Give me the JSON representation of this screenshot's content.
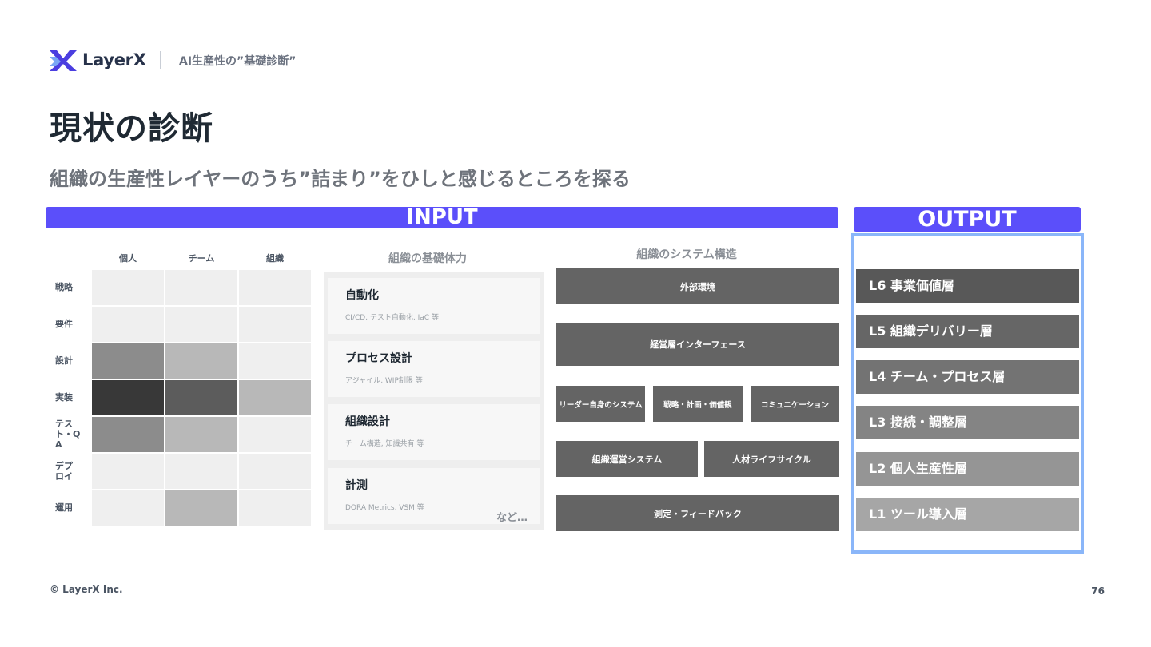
{
  "header": {
    "logo_text": "LayerX",
    "subtitle": "AI生産性の”基礎診断”"
  },
  "title": "現状の診断",
  "subtitle": "組織の生産性レイヤーのうち”詰まり”をひしと感じるところを探る",
  "input_label": "INPUT",
  "output_label": "OUTPUT",
  "matrix": {
    "columns": [
      "個人",
      "チーム",
      "組織"
    ],
    "rows": [
      "戦略",
      "要件",
      "設計",
      "実装",
      "テスト・QA",
      "デプロイ",
      "運用"
    ],
    "cell_colors": [
      [
        "#efefef",
        "#efefef",
        "#efefef"
      ],
      [
        "#efefef",
        "#efefef",
        "#efefef"
      ],
      [
        "#8c8c8c",
        "#b8b8b8",
        "#efefef"
      ],
      [
        "#383838",
        "#5c5c5c",
        "#b8b8b8"
      ],
      [
        "#8c8c8c",
        "#b8b8b8",
        "#efefef"
      ],
      [
        "#efefef",
        "#efefef",
        "#efefef"
      ],
      [
        "#efefef",
        "#b8b8b8",
        "#efefef"
      ]
    ]
  },
  "foundation": {
    "title": "組織の基礎体力",
    "cards": [
      {
        "title": "自動化",
        "desc": "CI/CD, テスト自動化, IaC 等"
      },
      {
        "title": "プロセス設計",
        "desc": "アジャイル, WIP制限 等"
      },
      {
        "title": "組織設計",
        "desc": "チーム構造, 知識共有 等"
      },
      {
        "title": "計測",
        "desc": "DORA Metrics, VSM 等"
      }
    ],
    "more": "など…"
  },
  "system": {
    "title": "組織のシステム構造",
    "boxes": {
      "external": "外部環境",
      "management_interface": "経営層インターフェース",
      "leader_system": "リーダー自身のシステム",
      "strategy": "戦略・計画・価値観",
      "communication": "コミュニケーション",
      "operation": "組織運営システム",
      "talent_cycle": "人材ライフサイクル",
      "feedback": "測定・フィードバック"
    }
  },
  "output_layers": [
    {
      "label": "L6 事業価値層",
      "color": "#585858"
    },
    {
      "label": "L5 組織デリバリー層",
      "color": "#666666"
    },
    {
      "label": "L4 チーム・プロセス層",
      "color": "#737373"
    },
    {
      "label": "L3 接続・調整層",
      "color": "#848484"
    },
    {
      "label": "L2 個人生産性層",
      "color": "#959595"
    },
    {
      "label": "L1 ツール導入層",
      "color": "#a6a6a6"
    }
  ],
  "footer": {
    "copyright": "© LayerX Inc.",
    "page_number": "76"
  },
  "colors": {
    "accent": "#5b4ffa",
    "output_frame": "#8ab6f9"
  }
}
